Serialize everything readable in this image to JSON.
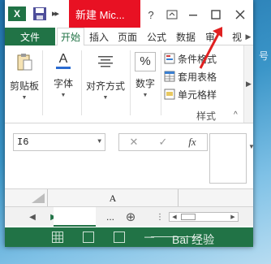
{
  "app": {
    "title": "新建 Mic...",
    "logo_letter": "X",
    "controls": {
      "help": "?",
      "ribbon_display": "⊡",
      "minimize": "—",
      "maximize": "☐",
      "close": "✕"
    }
  },
  "tabs": {
    "file": "文件",
    "items": [
      "开始",
      "插入",
      "页面",
      "公式",
      "数据",
      "审",
      "视"
    ],
    "active": "开始"
  },
  "ribbon": {
    "clipboard": "剪贴板",
    "font": "字体",
    "alignment": "对齐方式",
    "number": "数字",
    "number_symbol": "%",
    "font_symbol": "A",
    "styles": {
      "conditional": "条件格式",
      "table": "套用表格",
      "cell": "单元格样",
      "caption": "样式"
    }
  },
  "formula_bar": {
    "name_box": "I6",
    "cancel": "✕",
    "enter": "✓",
    "fx": "fx"
  },
  "grid": {
    "column_a": "A"
  },
  "sheetbar": {
    "more": "...",
    "add": "⊕"
  },
  "colors": {
    "excel_green": "#217346",
    "title_red": "#e81123",
    "arrow_red": "#e02020"
  },
  "watermark": "Bai 经验",
  "desktop_glyph": "号"
}
